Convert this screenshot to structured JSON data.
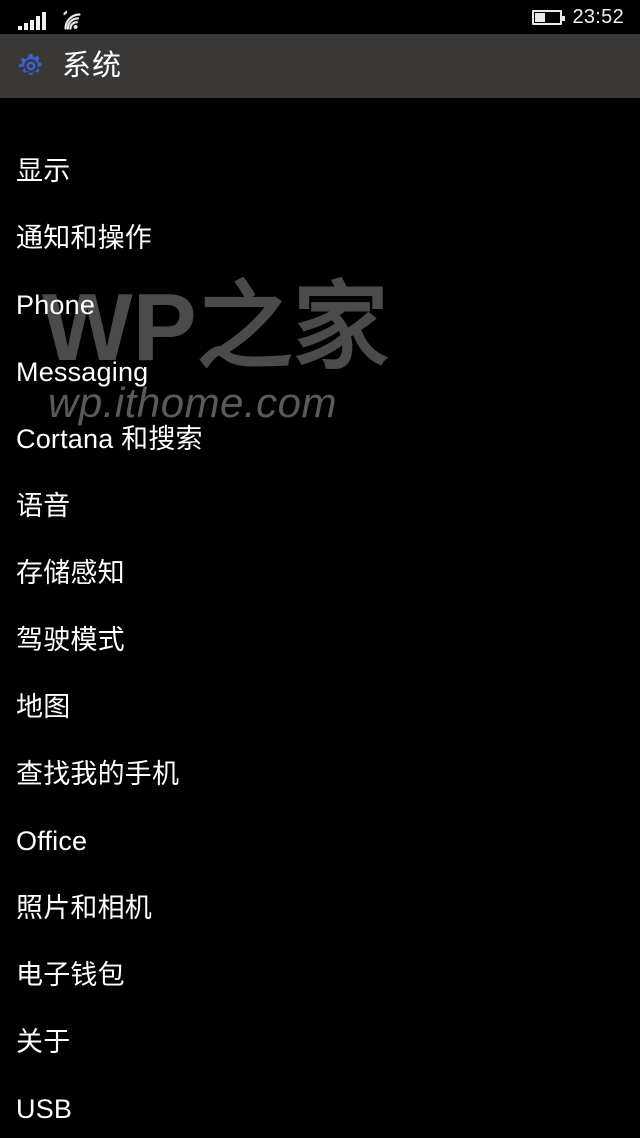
{
  "status_bar": {
    "signal_icon": "cellular-signal-icon",
    "signal_bars": 5,
    "wifi_icon": "wifi-icon",
    "battery_icon": "battery-icon",
    "battery_level_percent": 38,
    "time": "23:52"
  },
  "header": {
    "icon": "gear-icon",
    "icon_color": "#3a5fd9",
    "title": "系统",
    "background": "#3a3836"
  },
  "watermark": {
    "main_text": "WP之家",
    "sub_text": "wp.ithome.com",
    "color": "#4b4b4b"
  },
  "settings": {
    "items": [
      {
        "label": "显示"
      },
      {
        "label": "通知和操作"
      },
      {
        "label": "Phone"
      },
      {
        "label": "Messaging"
      },
      {
        "label": "Cortana 和搜索"
      },
      {
        "label": "语音"
      },
      {
        "label": "存储感知"
      },
      {
        "label": "驾驶模式"
      },
      {
        "label": "地图"
      },
      {
        "label": "查找我的手机"
      },
      {
        "label": "Office"
      },
      {
        "label": "照片和相机"
      },
      {
        "label": "电子钱包"
      },
      {
        "label": "关于"
      },
      {
        "label": "USB"
      }
    ]
  }
}
